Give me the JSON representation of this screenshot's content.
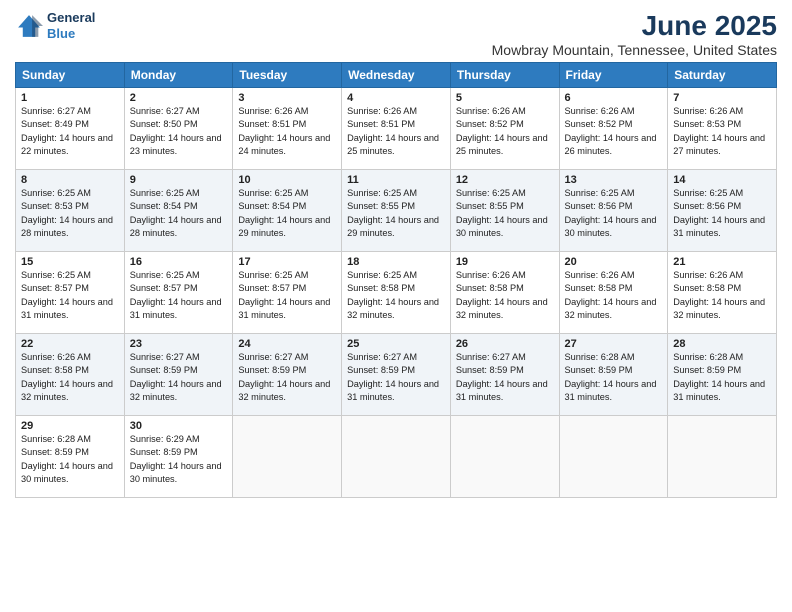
{
  "logo": {
    "line1": "General",
    "line2": "Blue"
  },
  "title": "June 2025",
  "subtitle": "Mowbray Mountain, Tennessee, United States",
  "weekdays": [
    "Sunday",
    "Monday",
    "Tuesday",
    "Wednesday",
    "Thursday",
    "Friday",
    "Saturday"
  ],
  "weeks": [
    [
      {
        "day": 1,
        "sunrise": "6:27 AM",
        "sunset": "8:49 PM",
        "daylight": "14 hours and 22 minutes."
      },
      {
        "day": 2,
        "sunrise": "6:27 AM",
        "sunset": "8:50 PM",
        "daylight": "14 hours and 23 minutes."
      },
      {
        "day": 3,
        "sunrise": "6:26 AM",
        "sunset": "8:51 PM",
        "daylight": "14 hours and 24 minutes."
      },
      {
        "day": 4,
        "sunrise": "6:26 AM",
        "sunset": "8:51 PM",
        "daylight": "14 hours and 25 minutes."
      },
      {
        "day": 5,
        "sunrise": "6:26 AM",
        "sunset": "8:52 PM",
        "daylight": "14 hours and 25 minutes."
      },
      {
        "day": 6,
        "sunrise": "6:26 AM",
        "sunset": "8:52 PM",
        "daylight": "14 hours and 26 minutes."
      },
      {
        "day": 7,
        "sunrise": "6:26 AM",
        "sunset": "8:53 PM",
        "daylight": "14 hours and 27 minutes."
      }
    ],
    [
      {
        "day": 8,
        "sunrise": "6:25 AM",
        "sunset": "8:53 PM",
        "daylight": "14 hours and 28 minutes."
      },
      {
        "day": 9,
        "sunrise": "6:25 AM",
        "sunset": "8:54 PM",
        "daylight": "14 hours and 28 minutes."
      },
      {
        "day": 10,
        "sunrise": "6:25 AM",
        "sunset": "8:54 PM",
        "daylight": "14 hours and 29 minutes."
      },
      {
        "day": 11,
        "sunrise": "6:25 AM",
        "sunset": "8:55 PM",
        "daylight": "14 hours and 29 minutes."
      },
      {
        "day": 12,
        "sunrise": "6:25 AM",
        "sunset": "8:55 PM",
        "daylight": "14 hours and 30 minutes."
      },
      {
        "day": 13,
        "sunrise": "6:25 AM",
        "sunset": "8:56 PM",
        "daylight": "14 hours and 30 minutes."
      },
      {
        "day": 14,
        "sunrise": "6:25 AM",
        "sunset": "8:56 PM",
        "daylight": "14 hours and 31 minutes."
      }
    ],
    [
      {
        "day": 15,
        "sunrise": "6:25 AM",
        "sunset": "8:57 PM",
        "daylight": "14 hours and 31 minutes."
      },
      {
        "day": 16,
        "sunrise": "6:25 AM",
        "sunset": "8:57 PM",
        "daylight": "14 hours and 31 minutes."
      },
      {
        "day": 17,
        "sunrise": "6:25 AM",
        "sunset": "8:57 PM",
        "daylight": "14 hours and 31 minutes."
      },
      {
        "day": 18,
        "sunrise": "6:25 AM",
        "sunset": "8:58 PM",
        "daylight": "14 hours and 32 minutes."
      },
      {
        "day": 19,
        "sunrise": "6:26 AM",
        "sunset": "8:58 PM",
        "daylight": "14 hours and 32 minutes."
      },
      {
        "day": 20,
        "sunrise": "6:26 AM",
        "sunset": "8:58 PM",
        "daylight": "14 hours and 32 minutes."
      },
      {
        "day": 21,
        "sunrise": "6:26 AM",
        "sunset": "8:58 PM",
        "daylight": "14 hours and 32 minutes."
      }
    ],
    [
      {
        "day": 22,
        "sunrise": "6:26 AM",
        "sunset": "8:58 PM",
        "daylight": "14 hours and 32 minutes."
      },
      {
        "day": 23,
        "sunrise": "6:27 AM",
        "sunset": "8:59 PM",
        "daylight": "14 hours and 32 minutes."
      },
      {
        "day": 24,
        "sunrise": "6:27 AM",
        "sunset": "8:59 PM",
        "daylight": "14 hours and 32 minutes."
      },
      {
        "day": 25,
        "sunrise": "6:27 AM",
        "sunset": "8:59 PM",
        "daylight": "14 hours and 31 minutes."
      },
      {
        "day": 26,
        "sunrise": "6:27 AM",
        "sunset": "8:59 PM",
        "daylight": "14 hours and 31 minutes."
      },
      {
        "day": 27,
        "sunrise": "6:28 AM",
        "sunset": "8:59 PM",
        "daylight": "14 hours and 31 minutes."
      },
      {
        "day": 28,
        "sunrise": "6:28 AM",
        "sunset": "8:59 PM",
        "daylight": "14 hours and 31 minutes."
      }
    ],
    [
      {
        "day": 29,
        "sunrise": "6:28 AM",
        "sunset": "8:59 PM",
        "daylight": "14 hours and 30 minutes."
      },
      {
        "day": 30,
        "sunrise": "6:29 AM",
        "sunset": "8:59 PM",
        "daylight": "14 hours and 30 minutes."
      },
      null,
      null,
      null,
      null,
      null
    ]
  ]
}
